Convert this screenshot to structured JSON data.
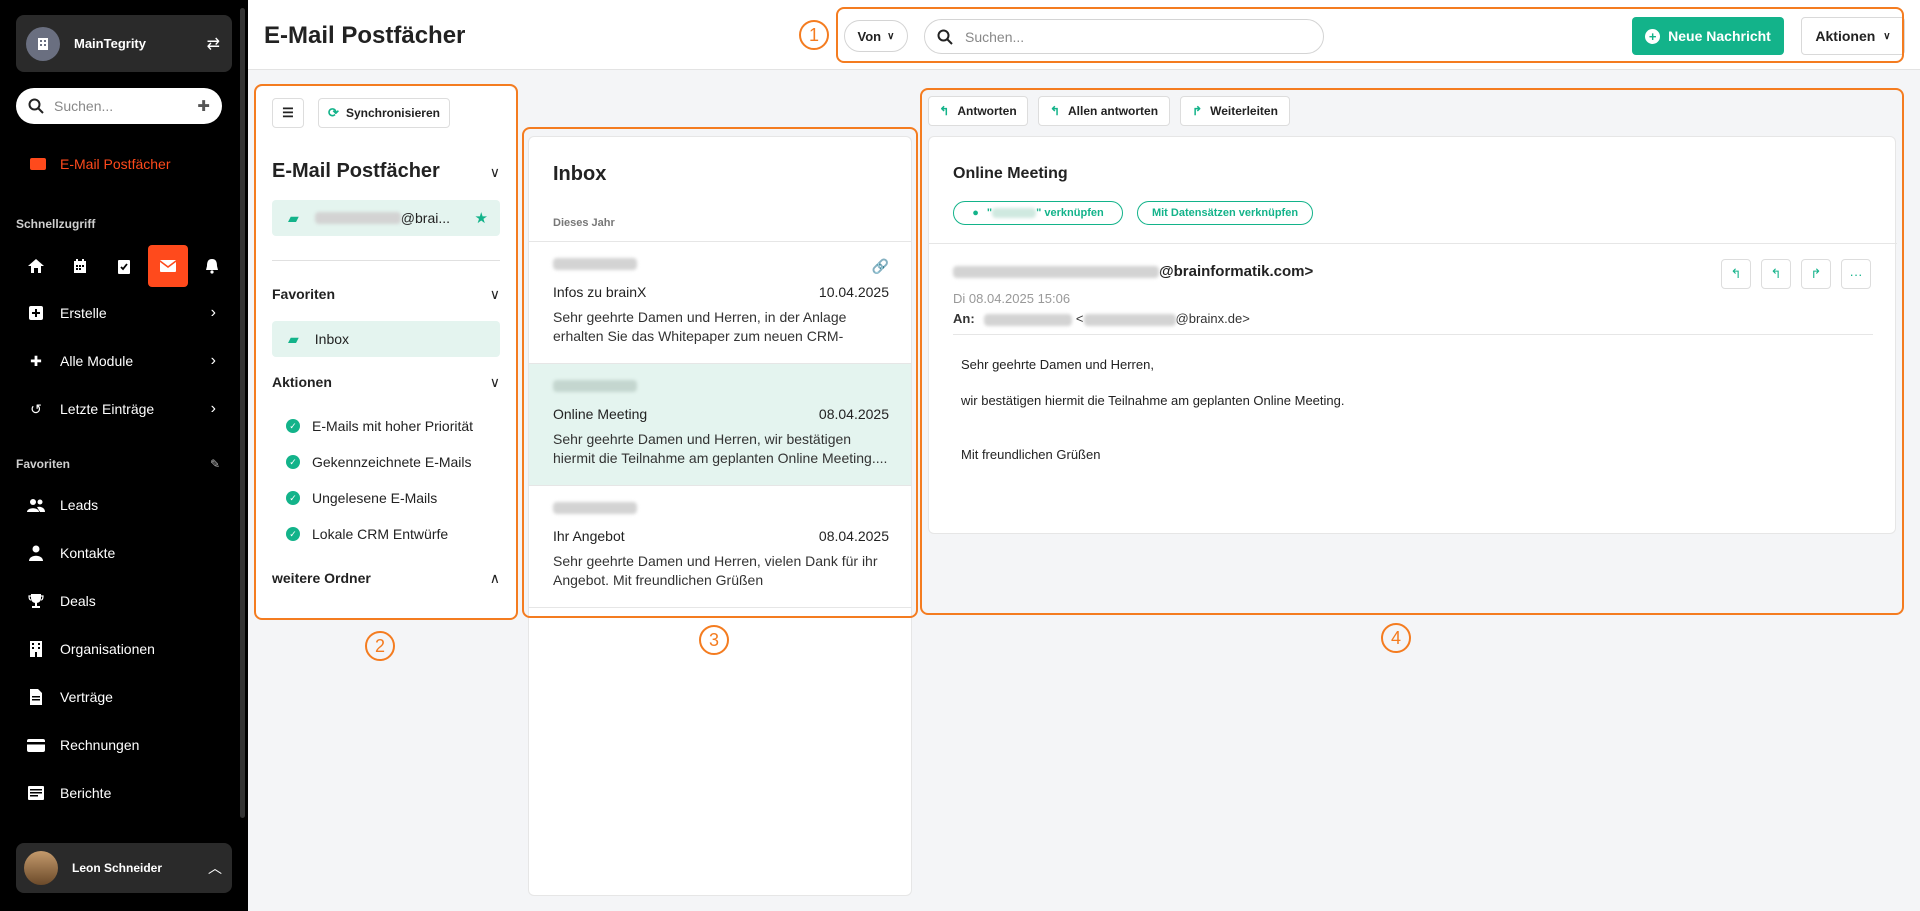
{
  "sidebar": {
    "company_name": "MainTegrity",
    "search_placeholder": "Suchen...",
    "active_item": "E-Mail Postfächer",
    "quick_access_label": "Schnellzugriff",
    "menu": [
      {
        "label": "Erstelle"
      },
      {
        "label": "Alle Module"
      },
      {
        "label": "Letzte Einträge"
      }
    ],
    "favorites_label": "Favoriten",
    "favorites": [
      {
        "label": "Leads"
      },
      {
        "label": "Kontakte"
      },
      {
        "label": "Deals"
      },
      {
        "label": "Organisationen"
      },
      {
        "label": "Verträge"
      },
      {
        "label": "Rechnungen"
      },
      {
        "label": "Berichte"
      }
    ],
    "user_name": "Leon Schneider"
  },
  "header": {
    "title": "E-Mail Postfächer",
    "von_label": "Von",
    "search_placeholder": "Suchen...",
    "new_message": "Neue Nachricht",
    "actions": "Aktionen"
  },
  "mailbox": {
    "sync_label": "Synchronisieren",
    "heading": "E-Mail Postfächer",
    "account_suffix": "@brai...",
    "favorites_label": "Favoriten",
    "favorite_inbox": "Inbox",
    "actions_label": "Aktionen",
    "actions": [
      {
        "label": "E-Mails mit hoher Priorität"
      },
      {
        "label": "Gekennzeichnete E-Mails"
      },
      {
        "label": "Ungelesene E-Mails"
      },
      {
        "label": "Lokale CRM Entwürfe"
      }
    ],
    "more_folders": "weitere Ordner"
  },
  "inbox": {
    "title": "Inbox",
    "group": "Dieses Jahr",
    "mails": [
      {
        "subject": "Infos zu brainX",
        "date": "10.04.2025",
        "preview": "Sehr geehrte Damen und Herren, in der Anlage erhalten Sie das Whitepaper zum neuen CRM-Syste..."
      },
      {
        "subject": "Online Meeting",
        "date": "08.04.2025",
        "preview": "Sehr geehrte Damen und Herren, wir bestätigen hiermit die Teilnahme am geplanten Online Meeting...."
      },
      {
        "subject": "Ihr Angebot",
        "date": "08.04.2025",
        "preview": "Sehr geehrte Damen und Herren, vielen Dank für ihr Angebot. Mit freundlichen Grüßen"
      }
    ]
  },
  "detail": {
    "reply": "Antworten",
    "reply_all": "Allen antworten",
    "forward": "Weiterleiten",
    "subject": "Online Meeting",
    "link_contact_suffix": "\" verknüpfen",
    "link_records": "Mit Datensätzen verknüpfen",
    "from_suffix": "@brainformatik.com>",
    "date": "Di 08.04.2025 15:06",
    "to_label": "An:",
    "to_suffix": "@brainx.de>",
    "body": [
      "Sehr geehrte Damen und Herren,",
      "wir bestätigen hiermit die Teilnahme am geplanten Online Meeting.",
      "Mit freundlichen Grüßen"
    ]
  },
  "callouts": [
    "1",
    "2",
    "3",
    "4"
  ],
  "colors": {
    "accent": "#13b38a",
    "active": "#ff4a1c",
    "callout": "#f47c20"
  }
}
